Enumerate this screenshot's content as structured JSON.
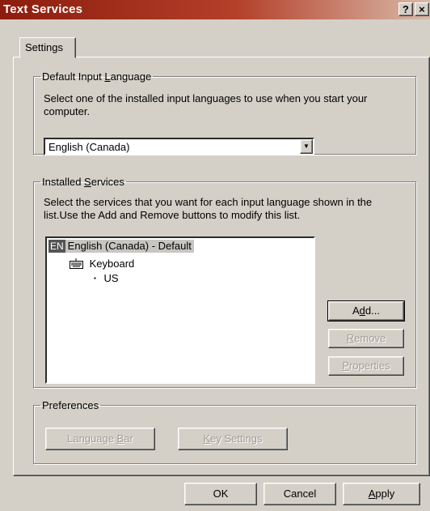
{
  "window": {
    "title": "Text Services",
    "help_glyph": "?",
    "close_glyph": "×"
  },
  "tabs": [
    {
      "label": "Settings"
    }
  ],
  "default_input": {
    "group_label_pre": "Default Input ",
    "group_label_key": "L",
    "group_label_post": "anguage",
    "description_line1": "Select one of the installed input languages to use when you start your",
    "description_line2": "computer.",
    "selected_value": "English (Canada)",
    "dropdown_glyph": "▼"
  },
  "installed_services": {
    "group_label_pre": "Installed ",
    "group_label_key": "S",
    "group_label_post": "ervices",
    "description_line1": "Select the services that you want for each input language shown in the",
    "description_line2": "list.Use the Add and Remove buttons to modify this list.",
    "tree": {
      "language_code": "EN",
      "language_label": "English (Canada) - Default",
      "category_label": "Keyboard",
      "category_icon": "keyboard-icon",
      "layout_label": "US",
      "bullet": "▪"
    },
    "buttons": {
      "add_pre": "A",
      "add_key": "d",
      "add_post": "d...",
      "remove_key": "R",
      "remove_post": "emove",
      "properties_key": "P",
      "properties_post": "roperties"
    }
  },
  "preferences": {
    "group_label": "Preferences",
    "language_bar_pre": "Language ",
    "language_bar_key": "B",
    "language_bar_post": "ar",
    "key_settings_key": "K",
    "key_settings_post": "ey Settings"
  },
  "footer": {
    "ok_label": "OK",
    "cancel_label": "Cancel",
    "apply_key": "A",
    "apply_post": "pply"
  }
}
